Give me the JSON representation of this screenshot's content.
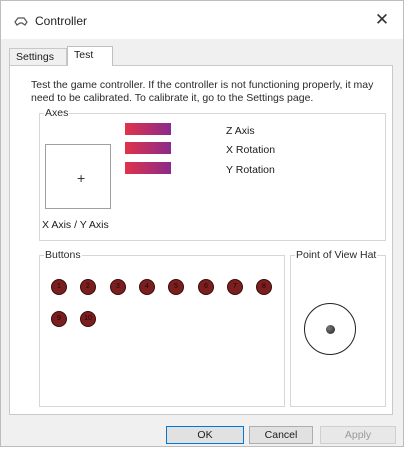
{
  "window": {
    "title": "Controller",
    "close_glyph": "✕",
    "icon": "gamepad-icon"
  },
  "tabs": [
    {
      "label": "Settings"
    },
    {
      "label": "Test"
    }
  ],
  "active_tab": "Test",
  "description": "Test the game controller.  If the controller is not functioning properly, it may need to be calibrated.  To calibrate it, go to the Settings page.",
  "axes": {
    "title": "Axes",
    "xy_label": "X Axis / Y Axis",
    "crosshair": "+",
    "bars": [
      {
        "label": "Z Axis"
      },
      {
        "label": "X Rotation"
      },
      {
        "label": "Y Rotation"
      }
    ],
    "bar_colors": [
      "#e0334a",
      "#8a2a8c"
    ]
  },
  "buttons": {
    "title": "Buttons",
    "items": [
      "1",
      "2",
      "3",
      "4",
      "5",
      "6",
      "7",
      "8",
      "9",
      "10"
    ],
    "color": "#7a1f1f"
  },
  "pov": {
    "title": "Point of View Hat"
  },
  "dialog": {
    "ok": "OK",
    "cancel": "Cancel",
    "apply": "Apply"
  }
}
